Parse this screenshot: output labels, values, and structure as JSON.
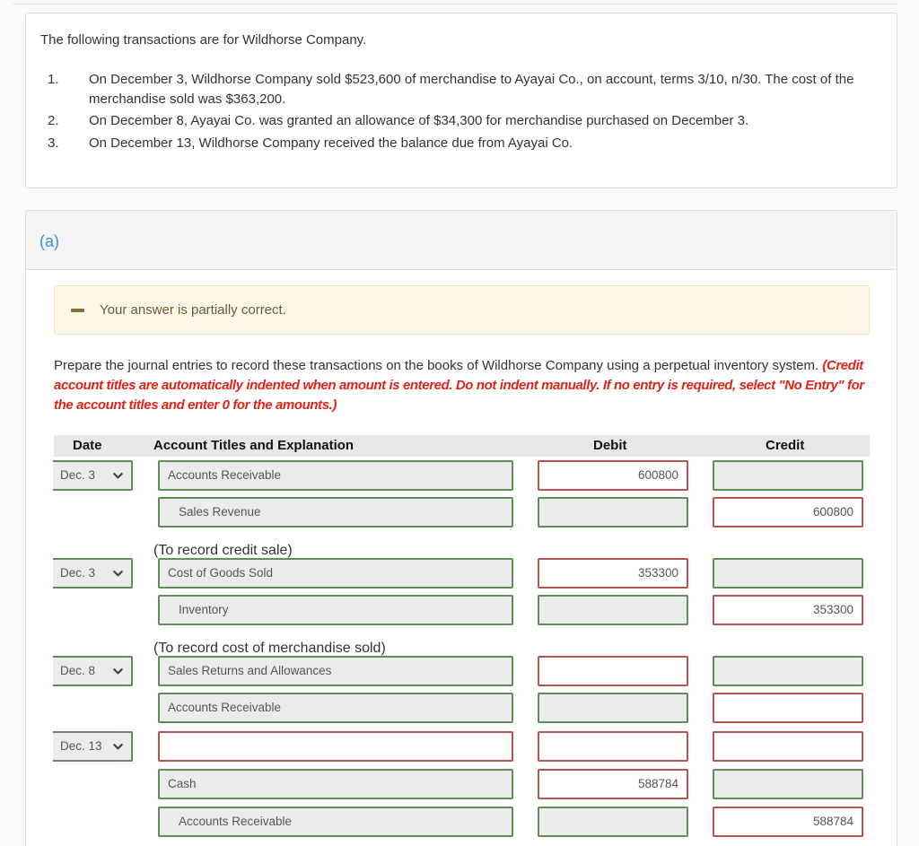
{
  "question": {
    "intro": "The following transactions are for Wildhorse Company.",
    "items": [
      {
        "num": "1.",
        "text": "On December 3, Wildhorse Company sold $523,600 of merchandise to Ayayai Co., on account, terms 3/10, n/30. The cost of the merchandise sold was $363,200."
      },
      {
        "num": "2.",
        "text": "On December 8, Ayayai Co. was granted an allowance of $34,300 for merchandise purchased on December 3."
      },
      {
        "num": "3.",
        "text": "On December 13, Wildhorse Company received the balance due from Ayayai Co."
      }
    ]
  },
  "part": {
    "label": "(a)",
    "feedback": {
      "icon": "minus-icon",
      "text": "Your answer is partially correct.",
      "status": "partial"
    },
    "instructions": "Prepare the journal entries to record these transactions on the books of Wildhorse Company using a perpetual inventory system.",
    "instructions_note": "(Credit account titles are automatically indented when amount is entered. Do not indent manually. If no entry is required, select \"No Entry\" for the account titles and enter 0 for the amounts.)"
  },
  "table": {
    "headers": {
      "date": "Date",
      "account": "Account Titles and Explanation",
      "debit": "Debit",
      "credit": "Credit"
    },
    "entries": [
      {
        "date": "Dec. 3",
        "date_status": "correct",
        "lines": [
          {
            "account": "Accounts Receivable",
            "account_status": "correct",
            "indent": false,
            "debit": "600800",
            "debit_status": "wrong",
            "credit": "",
            "credit_status": "correct"
          },
          {
            "account": "Sales Revenue",
            "account_status": "correct",
            "indent": true,
            "debit": "",
            "debit_status": "correct",
            "credit": "600800",
            "credit_status": "wrong"
          }
        ],
        "explanation": "(To record credit sale)"
      },
      {
        "date": "Dec. 3",
        "date_status": "correct",
        "lines": [
          {
            "account": "Cost of Goods Sold",
            "account_status": "correct",
            "indent": false,
            "debit": "353300",
            "debit_status": "wrong",
            "credit": "",
            "credit_status": "correct"
          },
          {
            "account": "Inventory",
            "account_status": "correct",
            "indent": true,
            "debit": "",
            "debit_status": "correct",
            "credit": "353300",
            "credit_status": "wrong"
          }
        ],
        "explanation": "(To record cost of merchandise sold)"
      },
      {
        "date": "Dec. 8",
        "date_status": "correct",
        "lines": [
          {
            "account": "Sales Returns and Allowances",
            "account_status": "correct",
            "indent": false,
            "debit": "",
            "debit_status": "wrong",
            "credit": "",
            "credit_status": "correct"
          },
          {
            "account": "Accounts Receivable",
            "account_status": "correct",
            "indent": false,
            "debit": "",
            "debit_status": "correct",
            "credit": "",
            "credit_status": "wrong"
          }
        ],
        "explanation": ""
      },
      {
        "date": "Dec. 13",
        "date_status": "correct",
        "lines": [
          {
            "account": "",
            "account_status": "wrong",
            "indent": false,
            "debit": "",
            "debit_status": "wrong",
            "credit": "",
            "credit_status": "wrong"
          },
          {
            "account": "Cash",
            "account_status": "correct",
            "indent": false,
            "debit": "588784",
            "debit_status": "wrong",
            "credit": "",
            "credit_status": "correct"
          },
          {
            "account": "Accounts Receivable",
            "account_status": "correct",
            "indent": true,
            "debit": "",
            "debit_status": "correct",
            "credit": "588784",
            "credit_status": "wrong"
          }
        ],
        "explanation": ""
      }
    ]
  }
}
